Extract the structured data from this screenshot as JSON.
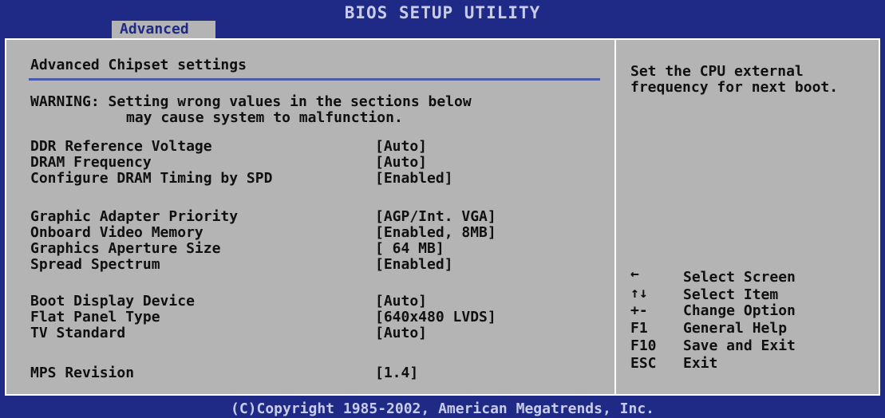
{
  "header": {
    "title": "BIOS SETUP UTILITY",
    "active_tab": "Advanced"
  },
  "main": {
    "section_title": "Advanced Chipset settings",
    "warning_line1": "WARNING: Setting wrong values in the sections below",
    "warning_line2": "may cause system to malfunction.",
    "settings": [
      {
        "label": "DDR Reference Voltage",
        "value": "[Auto]"
      },
      {
        "label": "DRAM Frequency",
        "value": "[Auto]"
      },
      {
        "label": "Configure DRAM Timing by SPD",
        "value": "[Enabled]"
      },
      {
        "label": "Graphic Adapter Priority",
        "value": "[AGP/Int. VGA]"
      },
      {
        "label": "Onboard Video Memory",
        "value": "[Enabled, 8MB]"
      },
      {
        "label": "Graphics Aperture Size",
        "value": "[ 64 MB]"
      },
      {
        "label": "Spread Spectrum",
        "value": "[Enabled]"
      },
      {
        "label": "Boot Display Device",
        "value": "[Auto]"
      },
      {
        "label": "Flat Panel Type",
        "value": "[640x480 LVDS]"
      },
      {
        "label": "TV Standard",
        "value": "[Auto]"
      },
      {
        "label": "MPS Revision",
        "value": "[1.4]"
      }
    ]
  },
  "help": {
    "text": "Set the CPU external frequency for next boot."
  },
  "keys": [
    {
      "key": "←",
      "icon": "arrow-left-icon",
      "desc": "Select Screen"
    },
    {
      "key": "↑↓",
      "icon": "arrow-up-down-icon",
      "desc": "Select Item"
    },
    {
      "key": "+-",
      "desc": "Change Option"
    },
    {
      "key": "F1",
      "desc": "General Help"
    },
    {
      "key": "F10",
      "desc": "Save and Exit"
    },
    {
      "key": "ESC",
      "desc": "Exit"
    }
  ],
  "footer": {
    "copyright": "(C)Copyright 1985-2002, American Megatrends, Inc."
  },
  "colors": {
    "background_blue": "#1e2a86",
    "panel_gray": "#b4b4b4",
    "text_dark": "#101010",
    "separator": "#4a5aa8"
  }
}
